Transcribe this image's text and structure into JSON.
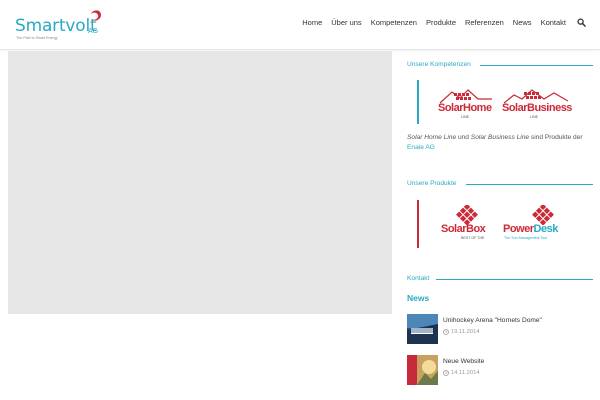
{
  "logo": {
    "name": "Smartvolt",
    "suffix": "AG",
    "tagline": "The Path to Smart Energy"
  },
  "nav": {
    "items": [
      "Home",
      "Über uns",
      "Kompetenzen",
      "Produkte",
      "Referenzen",
      "News",
      "Kontakt"
    ],
    "search_icon": "search-icon"
  },
  "colors": {
    "accent": "#2aa9c6",
    "brand_red": "#cc2a36",
    "placeholder": "#e6e6e6"
  },
  "sidebar": {
    "kompetenzen_title": "Unsere Kompetenzen",
    "produkte_title": "Unsere Produkte",
    "kontakt_title": "Kontakt",
    "brands": {
      "solar_home": {
        "a": "Solar",
        "b": "Home",
        "sub": "LINE"
      },
      "solar_business": {
        "a": "Solar",
        "b": "Business",
        "sub": "LINE"
      },
      "solar_box": {
        "a": "Solar",
        "b": "Box",
        "sub": "BEST OF THE"
      },
      "power_desk": {
        "a": "Power",
        "b": "Desk",
        "sub": "The Sun Management Tool"
      }
    },
    "paragraph": {
      "p1": "Solar Home Line",
      "p2": " und ",
      "p3": "Solar Business Line",
      "p4": " sind Produkte der ",
      "link": "Enaie AG"
    }
  },
  "news": {
    "title": "News",
    "items": [
      {
        "title": "Unihockey Arena \"Hornets Dome\"",
        "date": "19.11.2014"
      },
      {
        "title": "Neue Website",
        "date": "14.11.2014"
      }
    ]
  }
}
